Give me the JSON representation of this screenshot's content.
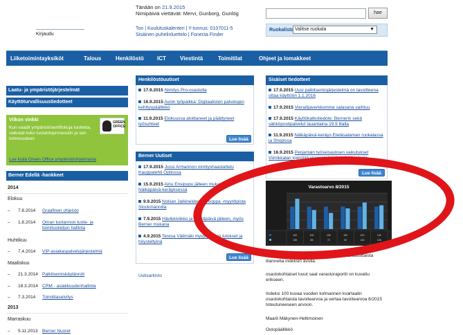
{
  "header": {
    "date_prefix": "Tänään on",
    "date": "21.9.2015",
    "nameday": "Nimipäiviä viettävät: Mervi, Gunborg, Gunlög",
    "line1": "Tori | Koulutuskalenteri | Y-tunnus: 0107011-5",
    "line2": "Sisäinen puhelinluettelo | Fonecta Finder",
    "left_link": "Kirjaudu",
    "search_button": "hae",
    "search_placeholder": "",
    "ruoka_label": "Ruokalista",
    "ruoka_select": "Valitse ruokala"
  },
  "nav": [
    "Liiketoimintayksiköt",
    "Talous",
    "Henkilöstö",
    "ICT",
    "Viestintä",
    "Toimitilat",
    "Ohjeet ja lomakkeet"
  ],
  "left": {
    "bar1": "Laatu- ja ympäristöjärjestelmät",
    "bar2": "Käyttöturvallisuustiedotteet",
    "green_title": "Viikon vinkki",
    "green_text": "Kun vaadit ympäristösertifioituja tuotteita, vaikutat koko tuotantoprosessiin ja sen toimivuuteen",
    "green_link": "Lue lisää Green Office ympäristöohjelmasta",
    "wwf_text": "GREEN OFFICE",
    "archive_title": "Berner Edellä -hankkeet",
    "groups": [
      {
        "year": "2014",
        "month": "Elokuu",
        "items": [
          {
            "date": "7.8.2014",
            "text": "Graafinen ohjeisto"
          },
          {
            "date": "1.8.2014",
            "text": "Oman tuotannon tuote- ja toimitusketjun hallinta"
          }
        ]
      },
      {
        "month": "Huhtikuu",
        "items": [
          {
            "date": "7.4.2014",
            "text": "VIP-asiakaspalvelujärjestelmä"
          }
        ]
      },
      {
        "month": "Maaliskuu",
        "items": [
          {
            "date": "21.3.2014",
            "text": "Palkitsemiskäytännöt"
          },
          {
            "date": "18.3.2014",
            "text": "CRM - asiakkuudenhallinta"
          },
          {
            "date": "7.3.2014",
            "text": "Toimitilaselvitys"
          }
        ]
      },
      {
        "year": "2013",
        "month": "Marraskuu",
        "items": [
          {
            "date": "5.11.2013",
            "text": "Berner Nuoret"
          }
        ]
      }
    ]
  },
  "henkilosto": {
    "title": "Henkilöstöuutiset",
    "items": [
      {
        "date": "17.9.2015",
        "text": "Nimitys Pro-osastolla"
      },
      {
        "date": "16.9.2015",
        "text": "Avoin työpaikka: Digitaalisten palvelujen kehityspäällikkö"
      },
      {
        "date": "11.9.2015",
        "text": "Elokuussa aloittaneet ja päättyneet työsuhteet"
      }
    ],
    "more": "Lue lisää"
  },
  "berner": {
    "title": "Berner Uutiset",
    "items": [
      {
        "date": "17.9.2015",
        "text": "Jussi Armannon nimityshaastattelu Kauppalehti Optiossa"
      },
      {
        "date": "15.9.2015",
        "text": "Ainu Ensipupu jälleen mukana Nälkäpäivä-keräyksessä"
      },
      {
        "date": "9.9.2015",
        "text": "Nokian Jalkineiden Eurooppa -myyntipiste Stockmannilla"
      },
      {
        "date": "7.9.2015",
        "text": "Hävikkiviikko ja Nälkäpäivä jälleen, myös Berner mukana"
      },
      {
        "date": "4.9.2015",
        "text": "Teresa Välimäki myyjäkurssin tulokset ja höysteltyinä"
      }
    ],
    "more": "Lue lisää",
    "archive": "Uutisarkisto"
  },
  "sisaiset": {
    "title": "Sisäiset tiedotteet",
    "items": [
      {
        "date": "17.9.2015",
        "text": "Uusi palkitsemisjärjestelmä on tavoitteena ottaa käyttöön 1.1.2016"
      },
      {
        "date": "17.9.2015",
        "text": "Vierailijaverkkomme salasana vaihtuu"
      },
      {
        "date": "17.9.2015",
        "text": "Käyttökatkotiedote: Bernerin sekä sähköpostipalvelut lauantaina 19.9 illalla"
      },
      {
        "date": "11.9.2015",
        "text": "Nälkäpäivä-keräys Eteläsataman ruokalassa ja Shopissa"
      },
      {
        "date": "16.9.2015",
        "text": "Perjantain työseisauksen vaikutukset Viimikkalan logistiikkatoimintoihin ja asiakkuuksiin"
      }
    ],
    "more": "Lue lisää",
    "para1": "Graafi kuvaa osastojen varastotasojen kuukausittaista tilannetta indeksin avulla.",
    "para2": "osastokohtaiset luvut saat varastoraportit on kuvattu erikseen.",
    "para3": "Indeksi 100 kuvaa vuoden kolmannen kvartaalin osastokohtaista tavoitearvoa ja vertaa tavoitearvoa 8/2015 toteutuneeseen arvoon.",
    "signature1": "Maarit Mäkynen-Heltimoinen",
    "signature2": "Ostopäällikkö"
  },
  "colors": {
    "nav": "#1a5fa3",
    "green": "#8fc43c",
    "highlight": "#e0151a",
    "bar_target": "#1e5ea8",
    "bar_actual": "#5fb4e8"
  },
  "chart_data": {
    "type": "bar",
    "title": "Varastoarvo 8/2015",
    "categories": [
      "",
      "",
      "",
      "",
      "",
      ""
    ],
    "series": [
      {
        "name": "",
        "values": [
          100,
          100,
          100,
          100,
          100,
          100
        ]
      },
      {
        "name": "",
        "values": [
          135,
          85,
          72,
          92,
          118,
          106
        ]
      }
    ],
    "ylim": [
      0,
      160
    ],
    "grid": true,
    "legend": "bottom-left"
  }
}
